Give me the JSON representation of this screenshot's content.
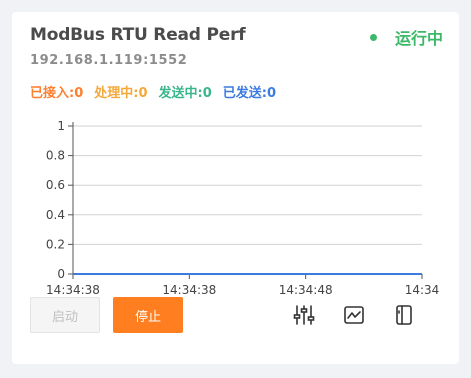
{
  "card": {
    "title": "ModBus RTU Read Perf",
    "address": "192.168.1.119:1552",
    "status": {
      "label": "运行中",
      "color": "#3cb868"
    }
  },
  "stats": [
    {
      "label": "已接入:",
      "value": "0",
      "color": "#ff7e2b"
    },
    {
      "label": "处理中:",
      "value": "0",
      "color": "#f5a83a"
    },
    {
      "label": "发送中:",
      "value": "0",
      "color": "#3bb58d"
    },
    {
      "label": "已发送:",
      "value": "0",
      "color": "#3c7be0"
    }
  ],
  "chart_data": {
    "type": "line",
    "x": [
      "14:34:38",
      "14:34:38",
      "14:34:48",
      "14:34"
    ],
    "series": [
      {
        "values": [
          0,
          0,
          0,
          0
        ],
        "color": "#3c7be0"
      }
    ],
    "y_ticks": [
      "0",
      "0.2",
      "0.4",
      "0.6",
      "0.8",
      "1"
    ],
    "ylim": [
      0,
      1
    ],
    "grid": true
  },
  "buttons": {
    "start_label": "启动",
    "stop_label": "停止"
  },
  "icons": [
    "sliders-icon",
    "chart-icon",
    "panel-icon"
  ]
}
